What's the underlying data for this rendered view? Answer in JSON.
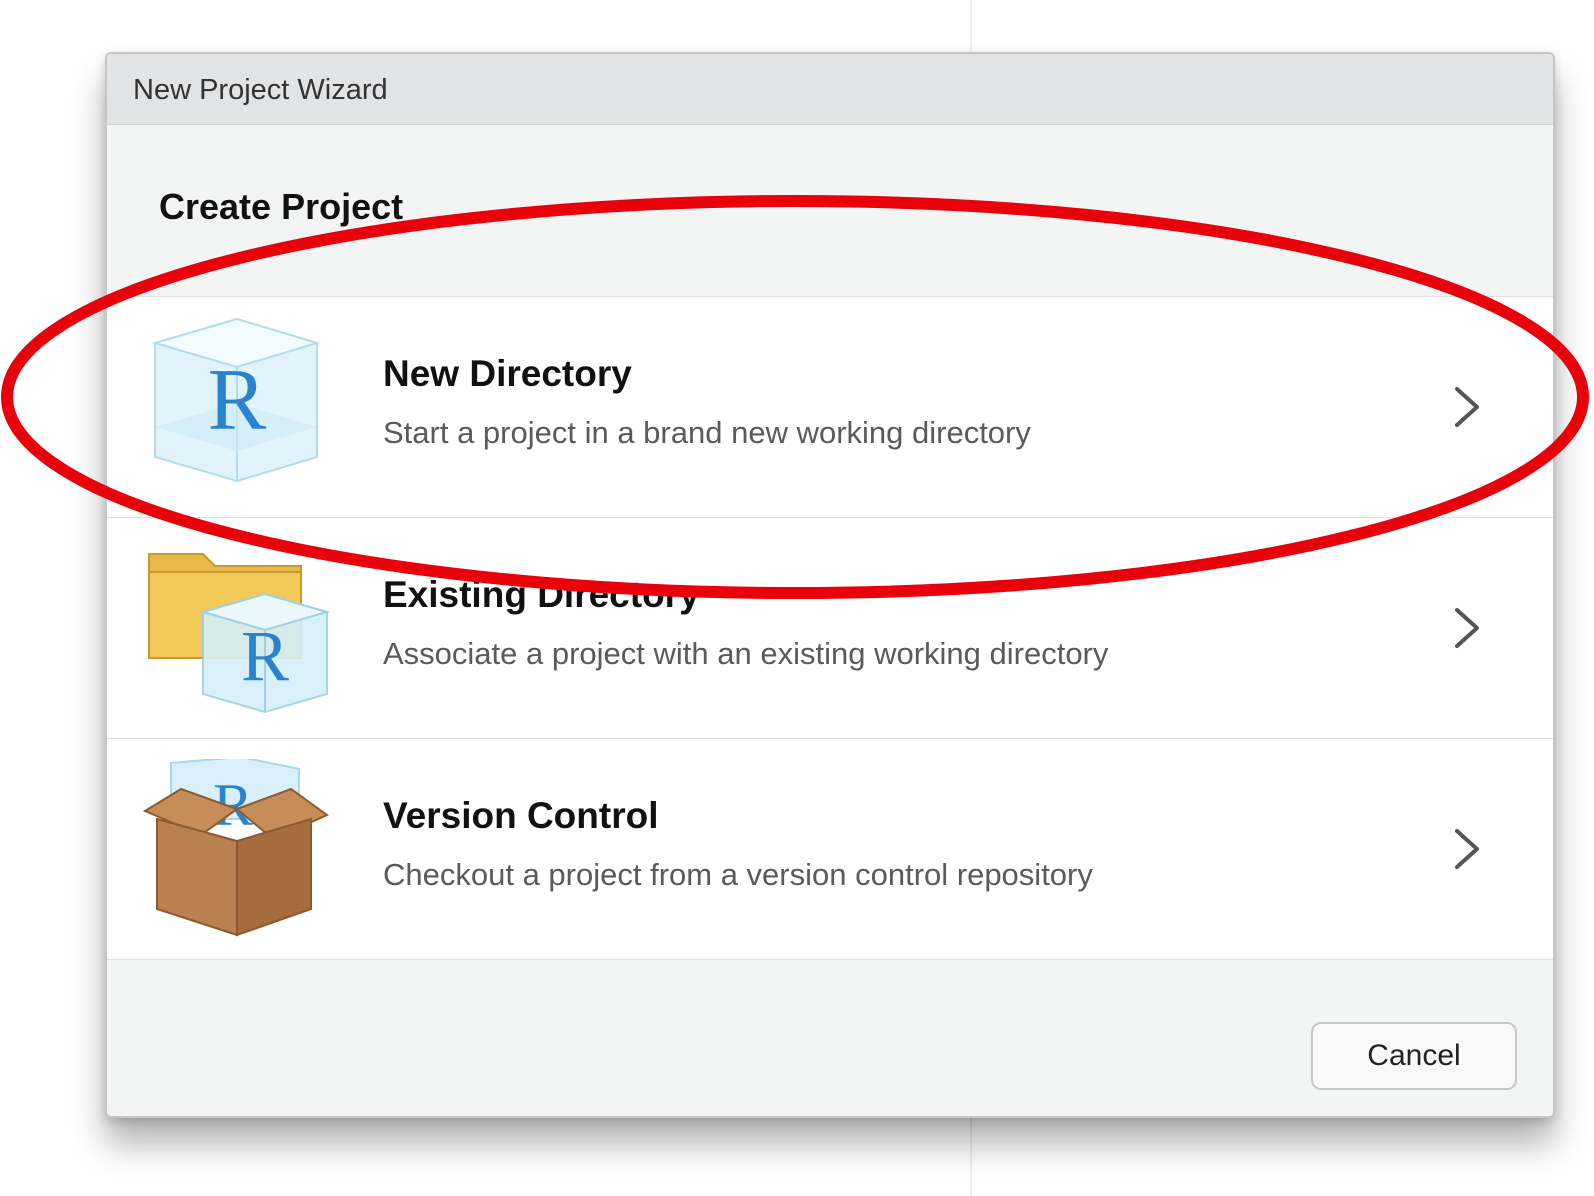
{
  "dialog": {
    "title": "New Project Wizard",
    "section_title": "Create Project",
    "cancel_label": "Cancel"
  },
  "options": [
    {
      "title": "New Directory",
      "description": "Start a project in a brand new working directory",
      "icon": "r-cube-icon"
    },
    {
      "title": "Existing Directory",
      "description": "Associate a project with an existing working directory",
      "icon": "folder-r-cube-icon"
    },
    {
      "title": "Version Control",
      "description": "Checkout a project from a version control repository",
      "icon": "box-r-icon"
    }
  ],
  "icon_glyphs": {
    "r_letter": "R"
  },
  "colors": {
    "annotation": "#e8000b",
    "r_blue": "#2a83cf",
    "folder": "#e8b94a",
    "box": "#b98150"
  }
}
